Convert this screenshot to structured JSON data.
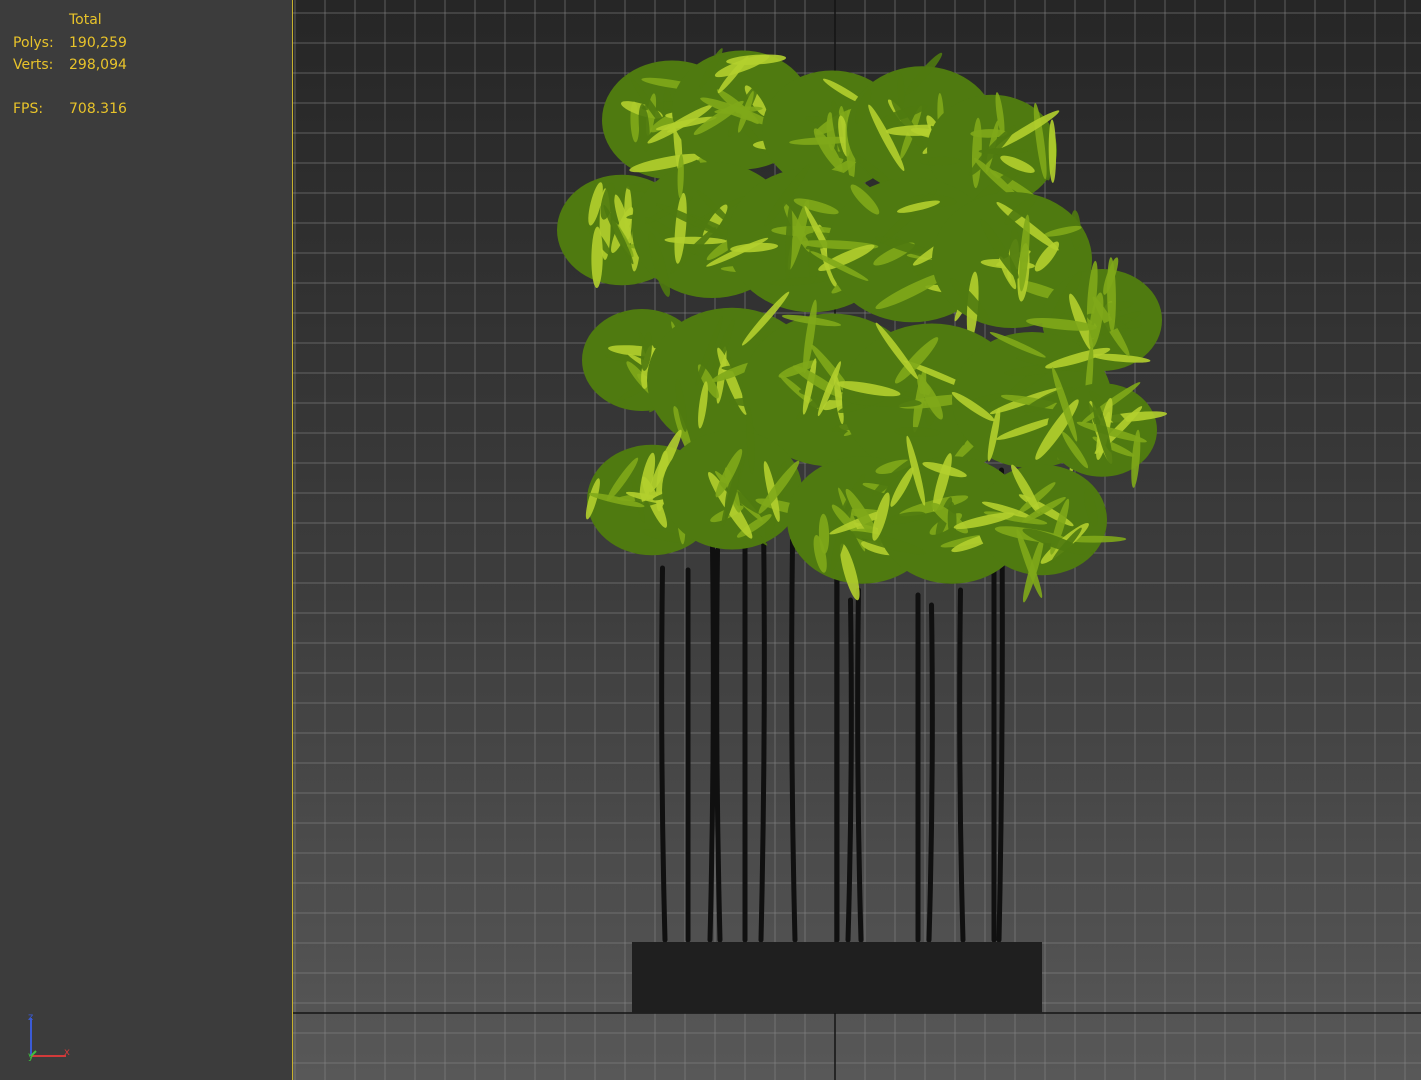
{
  "stats": {
    "header": "Total",
    "polys_label": "Polys:",
    "polys_value": "190,259",
    "verts_label": "Verts:",
    "verts_value": "298,094",
    "fps_label": "FPS:",
    "fps_value": "708.316"
  },
  "axis_gizmo": {
    "z_label": "z",
    "y_label": "y",
    "x_label": "x",
    "z_color": "#3b5bd6",
    "y_color": "#3fbf3f",
    "x_color": "#d23a3a"
  },
  "colors": {
    "stat_text": "#e8c32a",
    "viewport_border": "#c7b12e",
    "grid_line": "#8a8a8a",
    "planter": "#1f1f1f",
    "stem": "#101010",
    "foliage_dark": "#4f7a10",
    "foliage_mid": "#7fa81a",
    "foliage_light": "#b2cf2e"
  },
  "icons": [
    "axis-tripod-icon"
  ]
}
